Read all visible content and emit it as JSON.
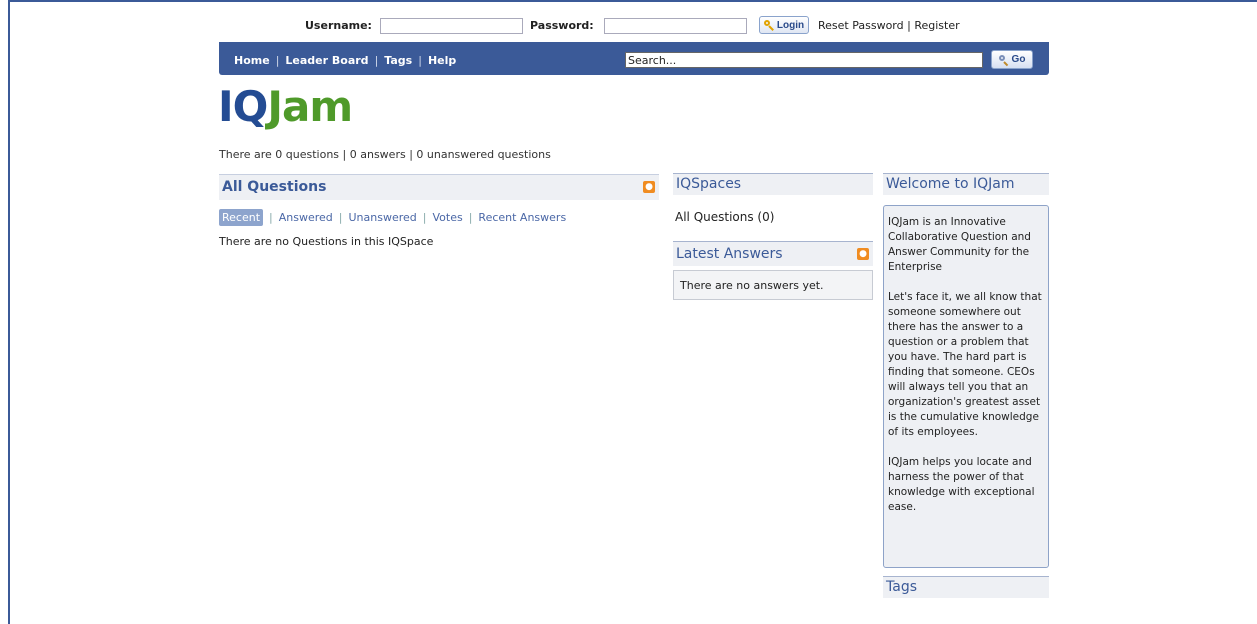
{
  "login": {
    "username_label": "Username:",
    "username_value": "",
    "password_label": "Password:",
    "password_value": "",
    "login_button": "Login",
    "reset_password": "Reset Password",
    "separator": "|",
    "register": "Register"
  },
  "nav": {
    "items": [
      "Home",
      "Leader Board",
      "Tags",
      "Help"
    ],
    "search_value": "Search...",
    "go_button": "Go"
  },
  "logo": {
    "part1": "IQ",
    "part2": "Jam"
  },
  "stats": "There are 0 questions | 0 answers | 0 unanswered questions",
  "all_questions": {
    "title": "All Questions",
    "tabs": [
      "Recent",
      "Answered",
      "Unanswered",
      "Votes",
      "Recent Answers"
    ],
    "active_tab": "Recent",
    "empty_text": "There are no Questions in this IQSpace"
  },
  "iqspaces": {
    "title": "IQSpaces",
    "link": "All Questions (0)"
  },
  "latest_answers": {
    "title": "Latest Answers",
    "empty_text": "There are no answers yet."
  },
  "welcome": {
    "title": "Welcome to IQJam",
    "paragraphs": [
      "IQJam is an Innovative Collaborative Question and Answer Community for the Enterprise",
      "Let's face it, we all know that someone somewhere out there has the answer to a question or a problem that you have. The hard part is finding that someone. CEOs will always tell you that an organization's greatest asset is the cumulative knowledge of its employees.",
      "IQJam helps you locate and harness the power of that knowledge with exceptional ease."
    ]
  },
  "tags": {
    "title": "Tags"
  },
  "colors": {
    "brand_blue": "#3b5a98",
    "logo_blue": "#244c93",
    "logo_green": "#4f9a2a",
    "rss_orange": "#f08c21",
    "panel_bg": "#eef0f4"
  },
  "icons": [
    "key-icon",
    "magnifier-icon",
    "rss-icon"
  ]
}
